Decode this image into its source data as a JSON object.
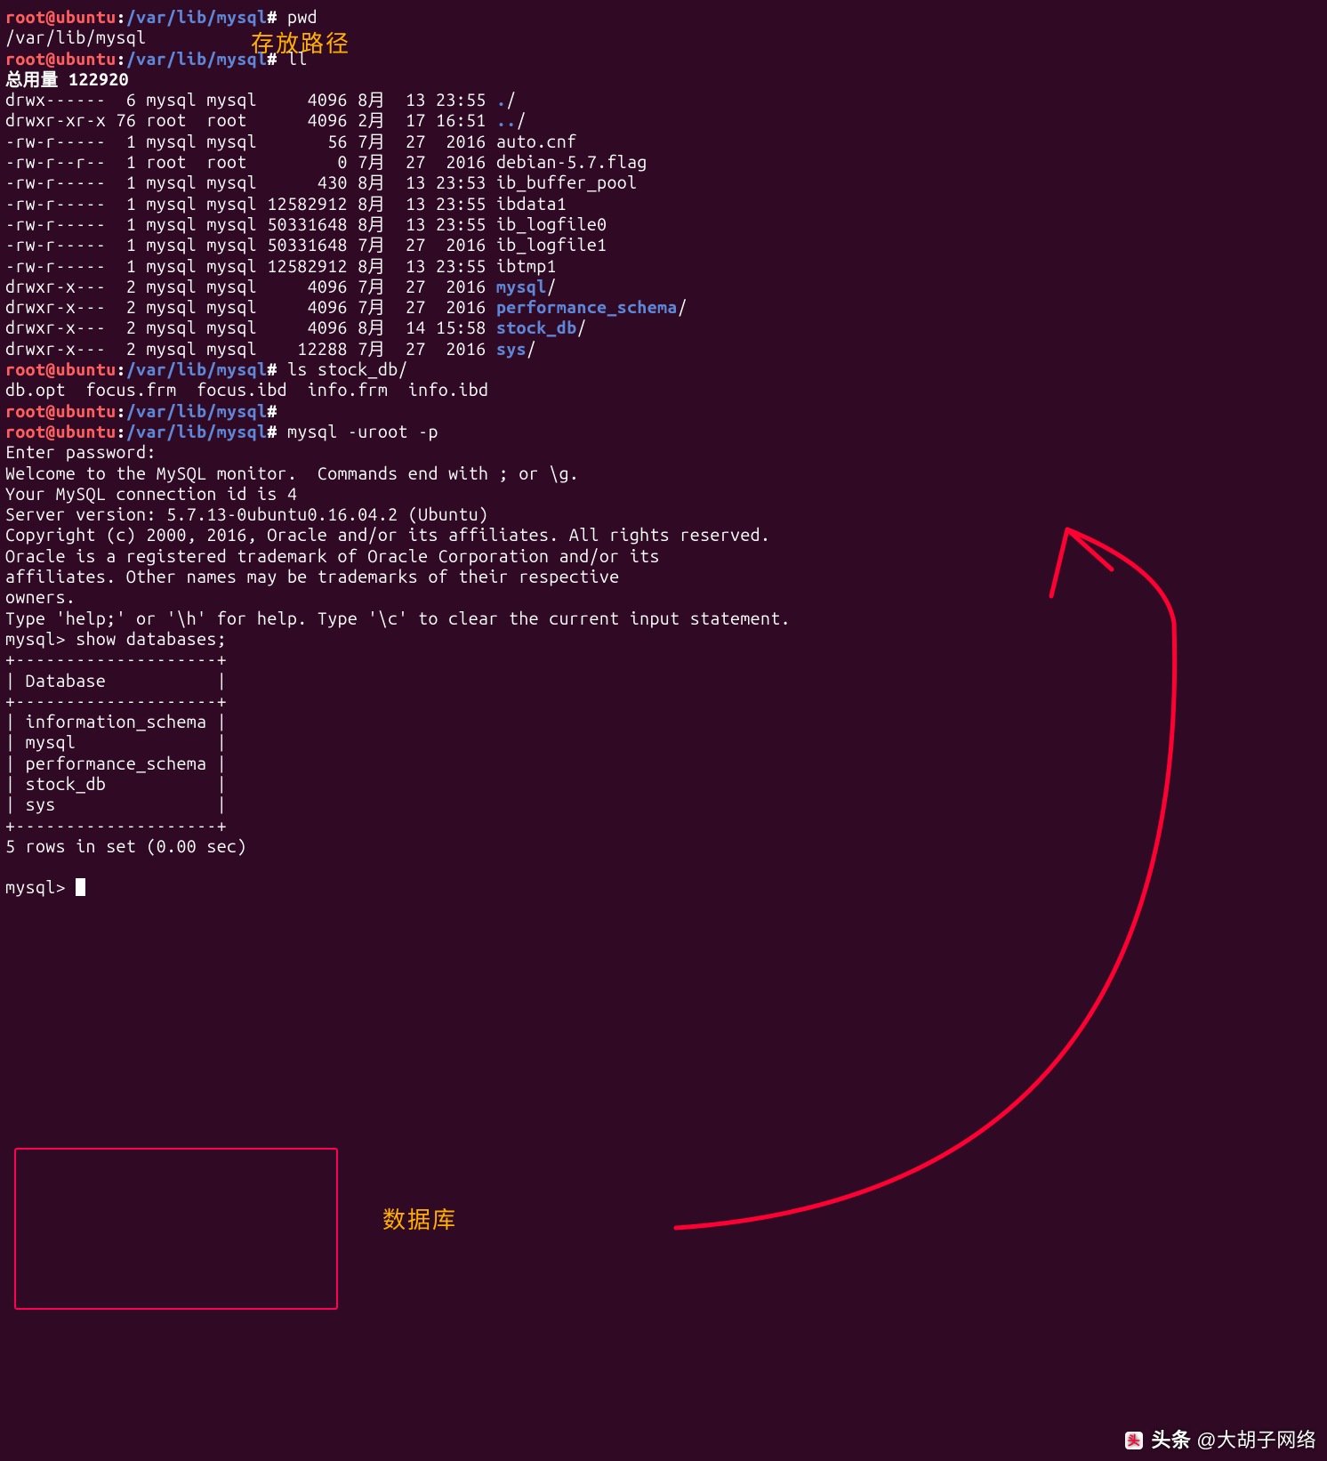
{
  "colors": {
    "bg": "#300a24",
    "fg": "#ffffff",
    "user": "#ff5f5f",
    "path": "#5f87d7",
    "dir": "#5f87d7",
    "anno": "#ffb000",
    "box": "#ff0055"
  },
  "prompt": {
    "user": "root@ubuntu",
    "sep": ":",
    "path": "/var/lib/mysql",
    "end": "#"
  },
  "commands": {
    "pwd": "pwd",
    "pwd_out": "/var/lib/mysql",
    "ll": "ll",
    "ls": "ls stock_db/",
    "ls_out": "db.opt  focus.frm  focus.ibd  info.frm  info.ibd",
    "mysql": "mysql -uroot -p"
  },
  "ll_header": "总用量 122920",
  "ll": [
    {
      "perm": "drwx------",
      "ln": " 6",
      "own": "mysql",
      "grp": "mysql",
      "size": "    4096",
      "mon": "8月",
      "day": "13",
      "time": "23:55",
      "name": ".",
      "dir": true,
      "slash": "/"
    },
    {
      "perm": "drwxr-xr-x",
      "ln": "76",
      "own": "root ",
      "grp": "root ",
      "size": "    4096",
      "mon": "2月",
      "day": "17",
      "time": "16:51",
      "name": "..",
      "dir": true,
      "slash": "/"
    },
    {
      "perm": "-rw-r-----",
      "ln": " 1",
      "own": "mysql",
      "grp": "mysql",
      "size": "      56",
      "mon": "7月",
      "day": "27",
      "time": " 2016",
      "name": "auto.cnf",
      "dir": false,
      "slash": ""
    },
    {
      "perm": "-rw-r--r--",
      "ln": " 1",
      "own": "root ",
      "grp": "root ",
      "size": "       0",
      "mon": "7月",
      "day": "27",
      "time": " 2016",
      "name": "debian-5.7.flag",
      "dir": false,
      "slash": ""
    },
    {
      "perm": "-rw-r-----",
      "ln": " 1",
      "own": "mysql",
      "grp": "mysql",
      "size": "     430",
      "mon": "8月",
      "day": "13",
      "time": "23:53",
      "name": "ib_buffer_pool",
      "dir": false,
      "slash": ""
    },
    {
      "perm": "-rw-r-----",
      "ln": " 1",
      "own": "mysql",
      "grp": "mysql",
      "size": "12582912",
      "mon": "8月",
      "day": "13",
      "time": "23:55",
      "name": "ibdata1",
      "dir": false,
      "slash": ""
    },
    {
      "perm": "-rw-r-----",
      "ln": " 1",
      "own": "mysql",
      "grp": "mysql",
      "size": "50331648",
      "mon": "8月",
      "day": "13",
      "time": "23:55",
      "name": "ib_logfile0",
      "dir": false,
      "slash": ""
    },
    {
      "perm": "-rw-r-----",
      "ln": " 1",
      "own": "mysql",
      "grp": "mysql",
      "size": "50331648",
      "mon": "7月",
      "day": "27",
      "time": " 2016",
      "name": "ib_logfile1",
      "dir": false,
      "slash": ""
    },
    {
      "perm": "-rw-r-----",
      "ln": " 1",
      "own": "mysql",
      "grp": "mysql",
      "size": "12582912",
      "mon": "8月",
      "day": "13",
      "time": "23:55",
      "name": "ibtmp1",
      "dir": false,
      "slash": ""
    },
    {
      "perm": "drwxr-x---",
      "ln": " 2",
      "own": "mysql",
      "grp": "mysql",
      "size": "    4096",
      "mon": "7月",
      "day": "27",
      "time": " 2016",
      "name": "mysql",
      "dir": true,
      "slash": "/"
    },
    {
      "perm": "drwxr-x---",
      "ln": " 2",
      "own": "mysql",
      "grp": "mysql",
      "size": "    4096",
      "mon": "7月",
      "day": "27",
      "time": " 2016",
      "name": "performance_schema",
      "dir": true,
      "slash": "/"
    },
    {
      "perm": "drwxr-x---",
      "ln": " 2",
      "own": "mysql",
      "grp": "mysql",
      "size": "    4096",
      "mon": "8月",
      "day": "14",
      "time": "15:58",
      "name": "stock_db",
      "dir": true,
      "slash": "/"
    },
    {
      "perm": "drwxr-x---",
      "ln": " 2",
      "own": "mysql",
      "grp": "mysql",
      "size": "   12288",
      "mon": "7月",
      "day": "27",
      "time": " 2016",
      "name": "sys",
      "dir": true,
      "slash": "/"
    }
  ],
  "mysql_login": [
    "Enter password:",
    "Welcome to the MySQL monitor.  Commands end with ; or \\g.",
    "Your MySQL connection id is 4",
    "Server version: 5.7.13-0ubuntu0.16.04.2 (Ubuntu)",
    "",
    "Copyright (c) 2000, 2016, Oracle and/or its affiliates. All rights reserved.",
    "",
    "Oracle is a registered trademark of Oracle Corporation and/or its",
    "affiliates. Other names may be trademarks of their respective",
    "owners.",
    "",
    "Type 'help;' or '\\h' for help. Type '\\c' to clear the current input statement.",
    ""
  ],
  "mysql_prompt": "mysql>",
  "mysql_cmd": "show databases;",
  "db_table": {
    "border": "+--------------------+",
    "header": "| Database           |",
    "rows": [
      "| information_schema |",
      "| mysql              |",
      "| performance_schema |",
      "| stock_db           |",
      "| sys                |"
    ],
    "footer": "5 rows in set (0.00 sec)"
  },
  "annotations": {
    "path_label": "存放路径",
    "db_label": "数据库"
  },
  "watermark": {
    "brand": "头条",
    "author": "@大胡子网络"
  }
}
